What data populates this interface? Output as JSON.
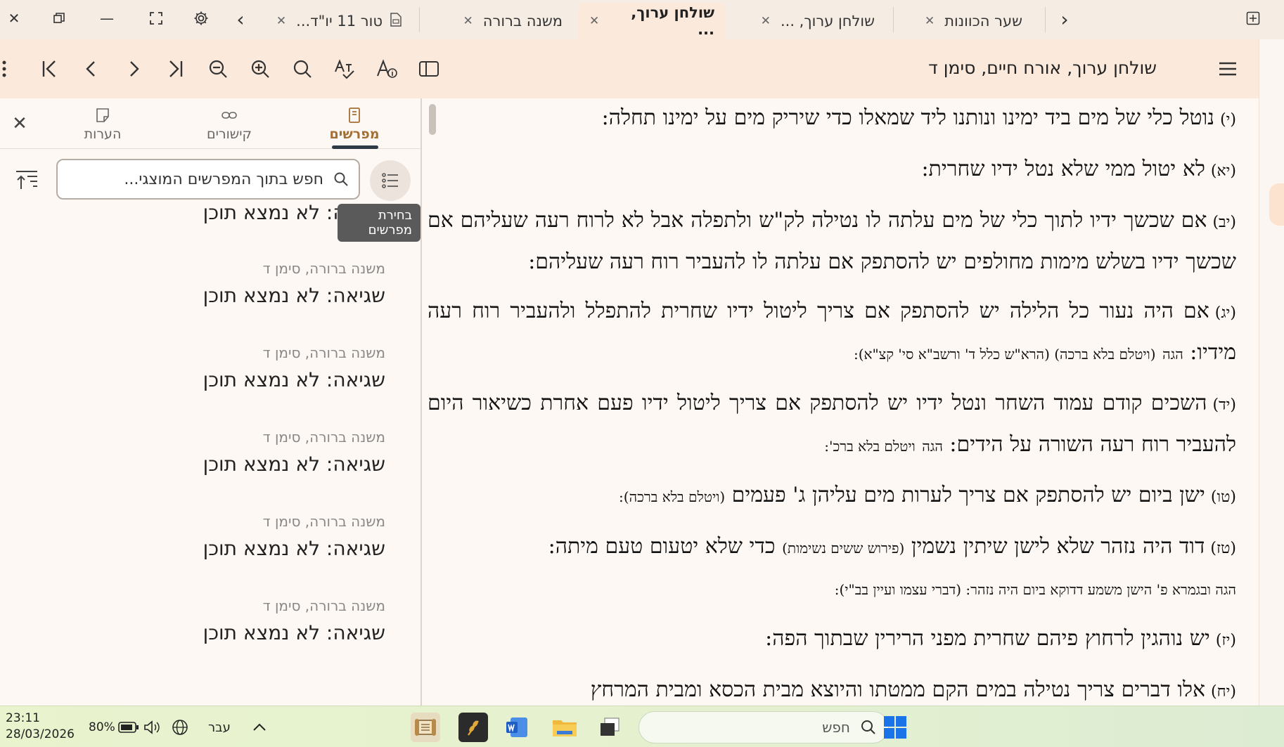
{
  "tabs": {
    "items": [
      {
        "label": "שער הכוונות",
        "active": false
      },
      {
        "label": "שולחן ערוך, ...",
        "active": false
      },
      {
        "label": "שולחן ערוך, ...",
        "active": true
      },
      {
        "label": "משנה ברורה",
        "active": false
      },
      {
        "label": "טור 11 יו\"ד...",
        "active": false
      }
    ]
  },
  "toolbar": {
    "doc_title": "שולחן ערוך, אורח חיים, סימן ד"
  },
  "main_text": {
    "paragraphs": [
      {
        "num": "(י)",
        "text": "נוטל כלי של מים ביד ימינו ונותנו ליד שמאלו כדי שיריק מים על ימינו תחלה:"
      },
      {
        "num": "(יא)",
        "text": "לא יטול ממי שלא נטל ידיו שחרית:"
      },
      {
        "num": "(יב)",
        "text": "אם שכשך ידיו לתוך כלי של מים עלתה לו נטילה לק\"ש ולתפלה אבל לא לרוח רעה שעליהם אם שכשך ידיו בשלש מימות מחולפים יש להסתפק אם עלתה לו להעביר רוח רעה שעליהם:"
      },
      {
        "num": "(יג)",
        "text": "אם היה נעור כל הלילה יש להסתפק אם צריך ליטול ידיו שחרית להתפלל ולהעביר רוח רעה מידיו:",
        "gloss_label": "הגה",
        "gloss": "(ויטלם בלא ברכה) (הרא\"ש כלל ד' ורשב\"א סי' קצ\"א):"
      },
      {
        "num": "(יד)",
        "text": "השכים קודם עמוד השחר ונטל ידיו יש להסתפק אם צריך ליטול ידיו פעם אחרת כשיאור היום להעביר רוח רעה השורה על הידים:",
        "gloss_label": "הגה",
        "gloss": "ויטלם בלא ברכ':"
      },
      {
        "num": "(טו)",
        "text": "ישן ביום יש להסתפק אם צריך לערות מים עליהן ג' פעמים",
        "gloss": "(ויטלם בלא ברכה):"
      },
      {
        "num": "(טז)",
        "text": "דוד היה נזהר שלא לישן שיתין נשמין",
        "gloss": "(פירוש ששים נשימות)",
        "text2": "כדי שלא יטעום טעם מיתה:",
        "sub": "הגה ובגמרא פ' הישן משמע דדוקא ביום היה נזהר: (דברי עצמו ועיין בב\"י):"
      },
      {
        "num": "(יז)",
        "text": "יש נוהגין לרחוץ פיהם שחרית מפני הרירין שבתוך הפה:"
      },
      {
        "num": "(יח)",
        "text": "אלו דברים צריך נטילה במים הקם ממטתו והיוצא מבית הכסא ומבית המרחץ"
      }
    ]
  },
  "side_panel": {
    "tabs": [
      {
        "label": "מפרשים",
        "active": true
      },
      {
        "label": "קישורים",
        "active": false
      },
      {
        "label": "הערות",
        "active": false
      }
    ],
    "search_placeholder": "חפש בתוך המפרשים המוצגי...",
    "tooltip": "בחירת מפרשים",
    "results": [
      {
        "source": "",
        "message": "שגיאה: לא נמצא תוכן"
      },
      {
        "source": "משנה ברורה, סימן ד",
        "message": "שגיאה: לא נמצא תוכן"
      },
      {
        "source": "משנה ברורה, סימן ד",
        "message": "שגיאה: לא נמצא תוכן"
      },
      {
        "source": "משנה ברורה, סימן ד",
        "message": "שגיאה: לא נמצא תוכן"
      },
      {
        "source": "משנה ברורה, סימן ד",
        "message": "שגיאה: לא נמצא תוכן"
      },
      {
        "source": "משנה ברורה, סימן ד",
        "message": "שגיאה: לא נמצא תוכן"
      }
    ]
  },
  "taskbar": {
    "time": "23:11",
    "date": "28/03/2026",
    "battery": "80%",
    "language": "עבר",
    "search_placeholder": "חפש"
  },
  "colors": {
    "accent": "#a56f33",
    "tab_active_bg": "#fbe9dc",
    "page_bg": "#fdf8f4"
  }
}
